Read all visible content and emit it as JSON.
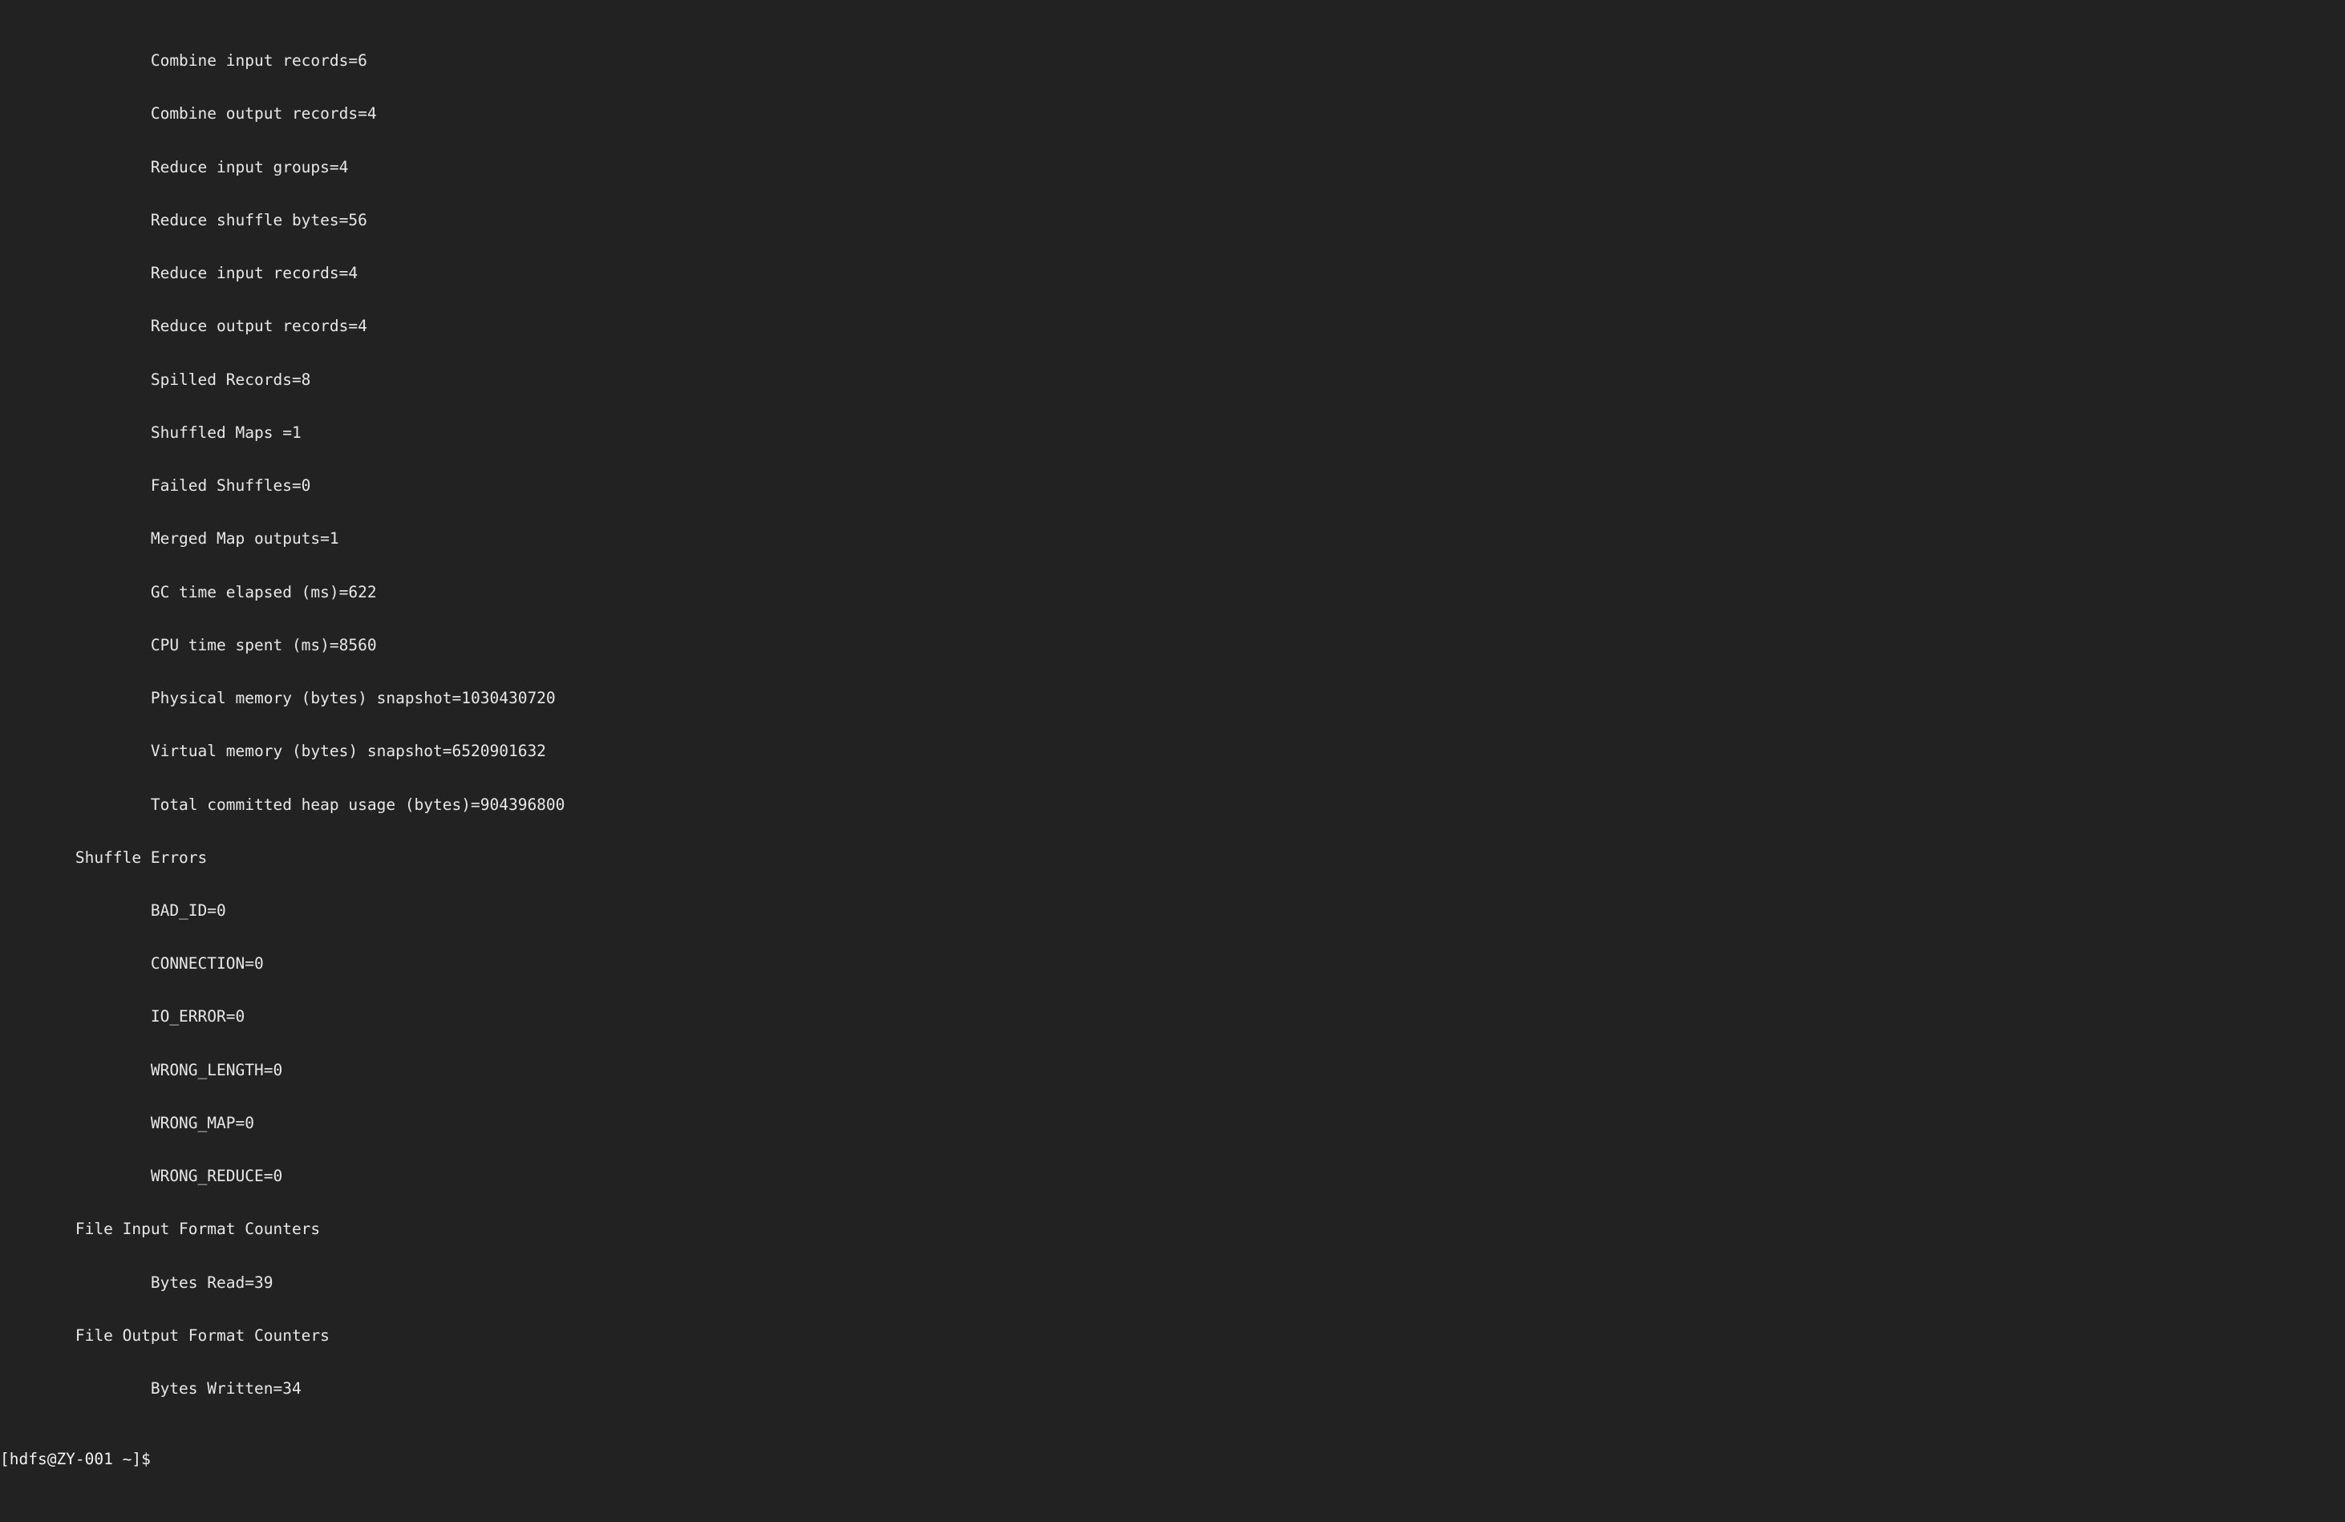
{
  "terminal": {
    "window_kind": "terminal-console",
    "background_color": "#222222",
    "foreground_color": "#e8e8e8",
    "font_kind": "monospace",
    "columns": 148,
    "rows": 24,
    "indent_unit_spaces": 4,
    "output_lines": [
      "                Combine input records=6",
      "                Combine output records=4",
      "                Reduce input groups=4",
      "                Reduce shuffle bytes=56",
      "                Reduce input records=4",
      "                Reduce output records=4",
      "                Spilled Records=8",
      "                Shuffled Maps =1",
      "                Failed Shuffles=0",
      "                Merged Map outputs=1",
      "                GC time elapsed (ms)=622",
      "                CPU time spent (ms)=8560",
      "                Physical memory (bytes) snapshot=1030430720",
      "                Virtual memory (bytes) snapshot=6520901632",
      "                Total committed heap usage (bytes)=904396800",
      "        Shuffle Errors",
      "                BAD_ID=0",
      "                CONNECTION=0",
      "                IO_ERROR=0",
      "                WRONG_LENGTH=0",
      "                WRONG_MAP=0",
      "                WRONG_REDUCE=0",
      "        File Input Format Counters ",
      "                Bytes Read=39",
      "        File Output Format Counters ",
      "                Bytes Written=34"
    ],
    "counters": {
      "combine_input_records": 6,
      "combine_output_records": 4,
      "reduce_input_groups": 4,
      "reduce_shuffle_bytes": 56,
      "reduce_input_records": 4,
      "reduce_output_records": 4,
      "spilled_records": 8,
      "shuffled_maps": 1,
      "failed_shuffles": 0,
      "merged_map_outputs": 1,
      "gc_time_elapsed_ms": 622,
      "cpu_time_spent_ms": 8560,
      "physical_memory_bytes_snapshot": 1030430720,
      "virtual_memory_bytes_snapshot": 6520901632,
      "total_committed_heap_usage_bytes": 904396800,
      "shuffle_errors": {
        "BAD_ID": 0,
        "CONNECTION": 0,
        "IO_ERROR": 0,
        "WRONG_LENGTH": 0,
        "WRONG_MAP": 0,
        "WRONG_REDUCE": 0
      },
      "file_input_format_bytes_read": 39,
      "file_output_format_bytes_written": 34
    },
    "prompt": {
      "text": "[hdfs@ZY-001 ~]$",
      "user": "hdfs",
      "host": "ZY-001",
      "cwd": "~",
      "symbol": "$"
    }
  }
}
